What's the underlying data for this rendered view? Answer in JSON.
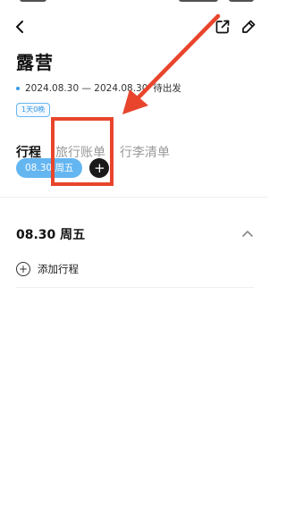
{
  "page": {
    "title": "露营",
    "date_range": "2024.08.30 — 2024.08.30",
    "status": "待出发",
    "duration": "1天0晚"
  },
  "tabs": [
    {
      "label": "行程",
      "active": true
    },
    {
      "label": "旅行账单",
      "active": false
    },
    {
      "label": "行李清单",
      "active": false
    }
  ],
  "day_selector": {
    "selected_day": "08.30 周五",
    "add_label": "+"
  },
  "day_section": {
    "header": "08.30 周五",
    "add_itinerary_label": "添加行程",
    "expanded": true
  },
  "icons": {
    "back": "back-chevron-icon",
    "share": "share-icon",
    "edit": "edit-icon",
    "collapse": "chevron-up-icon",
    "add_day": "plus-icon",
    "add_itinerary": "plus-circle-icon"
  },
  "colors": {
    "accent": "#3a9be6",
    "chip_bg": "#64b6f1",
    "annotation": "#e8452c"
  }
}
